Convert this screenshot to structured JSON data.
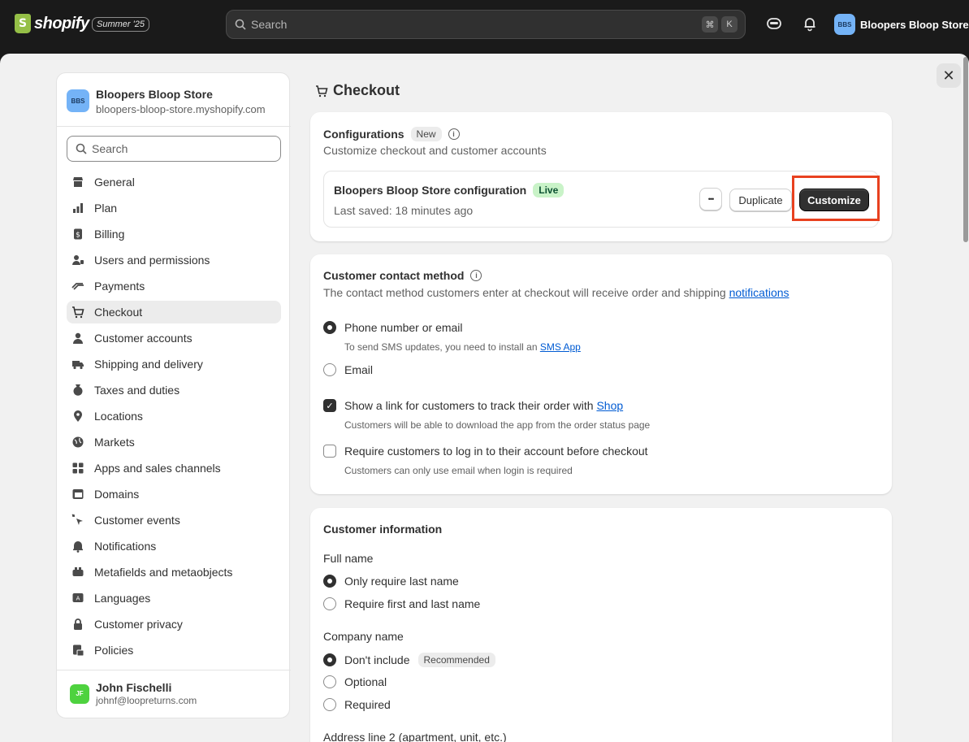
{
  "topbar": {
    "logo_text": "shopify",
    "edition": "Summer '25",
    "search_placeholder": "Search",
    "kbd_cmd": "⌘",
    "kbd_k": "K",
    "store_initials": "BBS",
    "store_name": "Bloopers Bloop Store"
  },
  "sidebar": {
    "store_initials": "BBS",
    "store_name": "Bloopers Bloop Store",
    "store_domain": "bloopers-bloop-store.myshopify.com",
    "search_placeholder": "Search",
    "items": [
      {
        "label": "General",
        "icon": "store-icon"
      },
      {
        "label": "Plan",
        "icon": "plan-icon"
      },
      {
        "label": "Billing",
        "icon": "billing-icon"
      },
      {
        "label": "Users and permissions",
        "icon": "users-icon"
      },
      {
        "label": "Payments",
        "icon": "payments-icon"
      },
      {
        "label": "Checkout",
        "icon": "cart-icon"
      },
      {
        "label": "Customer accounts",
        "icon": "person-icon"
      },
      {
        "label": "Shipping and delivery",
        "icon": "truck-icon"
      },
      {
        "label": "Taxes and duties",
        "icon": "taxes-icon"
      },
      {
        "label": "Locations",
        "icon": "location-icon"
      },
      {
        "label": "Markets",
        "icon": "globe-icon"
      },
      {
        "label": "Apps and sales channels",
        "icon": "apps-icon"
      },
      {
        "label": "Domains",
        "icon": "domains-icon"
      },
      {
        "label": "Customer events",
        "icon": "cursor-icon"
      },
      {
        "label": "Notifications",
        "icon": "bell-icon"
      },
      {
        "label": "Metafields and metaobjects",
        "icon": "metafields-icon"
      },
      {
        "label": "Languages",
        "icon": "language-icon"
      },
      {
        "label": "Customer privacy",
        "icon": "lock-icon"
      },
      {
        "label": "Policies",
        "icon": "policies-icon"
      }
    ],
    "user_initials": "JF",
    "user_name": "John Fischelli",
    "user_email": "johnf@loopreturns.com"
  },
  "main": {
    "title": "Checkout",
    "configurations": {
      "title": "Configurations",
      "badge": "New",
      "subtitle": "Customize checkout and customer accounts",
      "config_name": "Bloopers Bloop Store configuration",
      "config_badge": "Live",
      "last_saved": "Last saved: 18 minutes ago",
      "more_label": "•••",
      "duplicate_label": "Duplicate",
      "customize_label": "Customize"
    },
    "contact": {
      "title": "Customer contact method",
      "desc_prefix": "The contact method customers enter at checkout will receive order and shipping ",
      "desc_link": "notifications",
      "opt_phone": "Phone number or email",
      "opt_phone_help_prefix": "To send SMS updates, you need to install an ",
      "opt_phone_help_link": "SMS App",
      "opt_email": "Email",
      "track_prefix": "Show a link for customers to track their order with ",
      "track_link": "Shop",
      "track_help": "Customers will be able to download the app from the order status page",
      "login_label": "Require customers to log in to their account before checkout",
      "login_help": "Customers can only use email when login is required"
    },
    "info": {
      "title": "Customer information",
      "full_name_label": "Full name",
      "fn_opt1": "Only require last name",
      "fn_opt2": "Require first and last name",
      "company_label": "Company name",
      "co_opt1": "Don't include",
      "co_opt1_badge": "Recommended",
      "co_opt2": "Optional",
      "co_opt3": "Required",
      "address2_label": "Address line 2 (apartment, unit, etc.)"
    }
  }
}
